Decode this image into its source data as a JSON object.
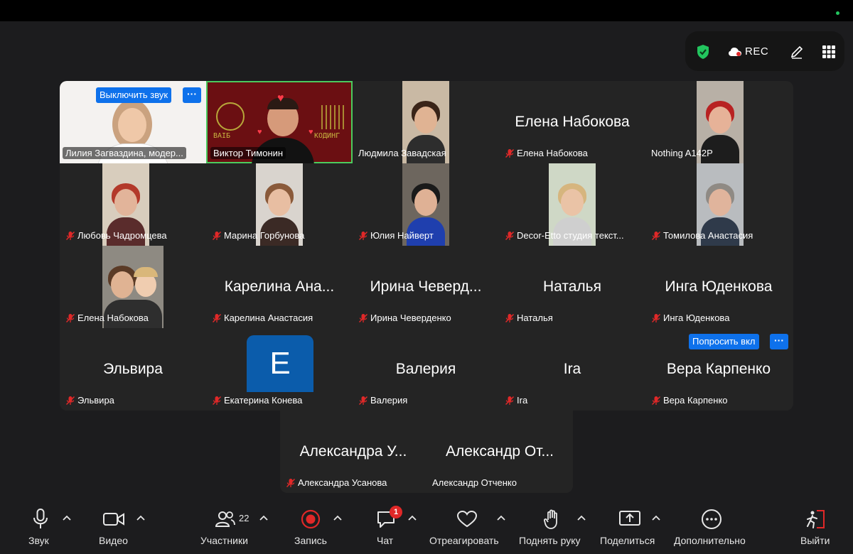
{
  "status_bar": {
    "rec_label": "REC"
  },
  "speaker_tile": {
    "mute_button": "Выключить звук",
    "more": "···"
  },
  "ask_tile": {
    "ask_button": "Попросить вкл",
    "more": "···"
  },
  "virtual_background": {
    "left_text": "BAIБ",
    "right_text": "КОДИНГ"
  },
  "avatar_letter": "E",
  "tiles": [
    {
      "label": "Лилия Загваздина, модер...",
      "muted": false
    },
    {
      "label": "Виктор Тимонин",
      "muted": false
    },
    {
      "label": "Людмила Завадская",
      "muted": false
    },
    {
      "big_name": "Елена Набокова",
      "label": "Елена Набокова",
      "muted": true
    },
    {
      "label": "Nothing A142P",
      "muted": false
    },
    {
      "label": "Любовь Чадромцева",
      "muted": true
    },
    {
      "label": "Марина Горбунова",
      "muted": true
    },
    {
      "label": "Юлия Найверт",
      "muted": true
    },
    {
      "label": "Decor-Etto студия текст...",
      "muted": true
    },
    {
      "label": "Томилова Анастасия",
      "muted": true
    },
    {
      "label": "Елена Набокова",
      "muted": true
    },
    {
      "big_name": "Карелина Ана...",
      "label": "Карелина Анастасия",
      "muted": true
    },
    {
      "big_name": "Ирина Чеверд...",
      "label": "Ирина Чеверденко",
      "muted": true
    },
    {
      "big_name": "Наталья",
      "label": "Наталья",
      "muted": true
    },
    {
      "big_name": "Инга Юденкова",
      "label": "Инга Юденкова",
      "muted": true
    },
    {
      "big_name": "Эльвира",
      "label": "Эльвира",
      "muted": true
    },
    {
      "label": "Екатерина Конева",
      "muted": true
    },
    {
      "big_name": "Валерия",
      "label": "Валерия",
      "muted": true
    },
    {
      "big_name": "Ira",
      "label": "Ira",
      "muted": true
    },
    {
      "big_name": "Вера Карпенко",
      "label": "Вера Карпенко",
      "muted": true
    },
    {
      "big_name": "Александра У...",
      "label": "Александра Усанова",
      "muted": true
    },
    {
      "big_name": "Александр От...",
      "label": "Александр Отченко",
      "muted": false
    }
  ],
  "toolbar": {
    "audio": "Звук",
    "video": "Видео",
    "participants": "Участники",
    "participants_count": "22",
    "record": "Запись",
    "chat": "Чат",
    "chat_badge": "1",
    "react": "Отреагировать",
    "raise_hand": "Поднять руку",
    "share": "Поделиться",
    "more": "Дополнительно",
    "leave": "Выйти"
  },
  "colors": {
    "accent_blue": "#0e71eb",
    "active_speaker_border": "#4ccb5e",
    "record_red": "#e02828",
    "shield_green": "#22c55e"
  }
}
